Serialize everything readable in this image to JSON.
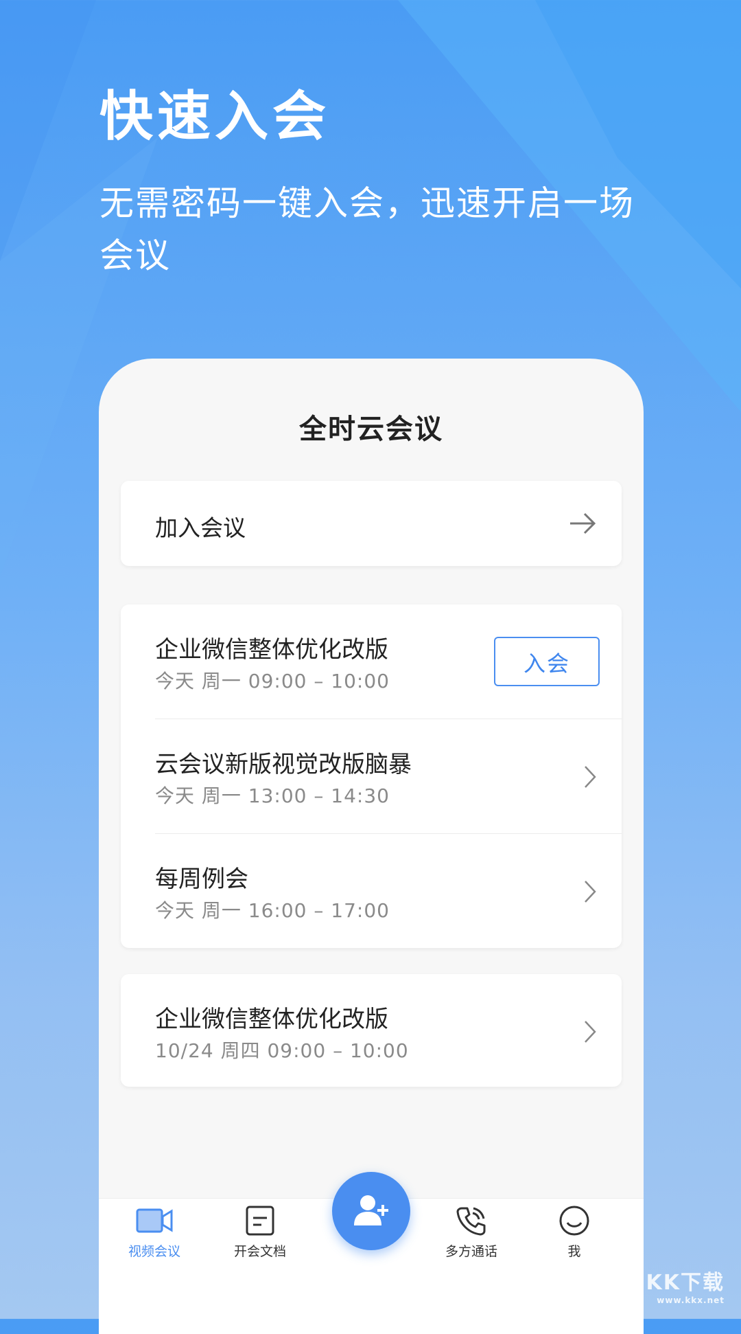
{
  "hero": {
    "title": "快速入会",
    "subtitle": "无需密码一键入会，迅速开启一场会议"
  },
  "app": {
    "title": "全时云会议",
    "join_label": "加入会议"
  },
  "meetings_today": [
    {
      "title": "企业微信整体优化改版",
      "time": "今天 周一  09:00 – 10:00",
      "action": "入会"
    },
    {
      "title": "云会议新版视觉改版脑暴",
      "time": "今天 周一 13:00 – 14:30"
    },
    {
      "title": "每周例会",
      "time": "今天 周一 16:00 – 17:00"
    }
  ],
  "meetings_future": [
    {
      "title": "企业微信整体优化改版",
      "time": "10/24 周四 09:00 – 10:00"
    }
  ],
  "tabs": [
    {
      "label": "视频会议",
      "icon": "video-camera-icon",
      "active": true
    },
    {
      "label": "开会文档",
      "icon": "document-icon",
      "active": false
    },
    {
      "label": "多方通话",
      "icon": "phone-call-icon",
      "active": false
    },
    {
      "label": "我",
      "icon": "smiley-profile-icon",
      "active": false
    }
  ],
  "fab_icon": "add-contact-icon",
  "watermark": {
    "logo": "KK下载",
    "url": "www.kkx.net"
  },
  "colors": {
    "accent": "#4a8ef0",
    "background_top": "#4a9cf4",
    "background_bottom": "#a4c8f1"
  }
}
